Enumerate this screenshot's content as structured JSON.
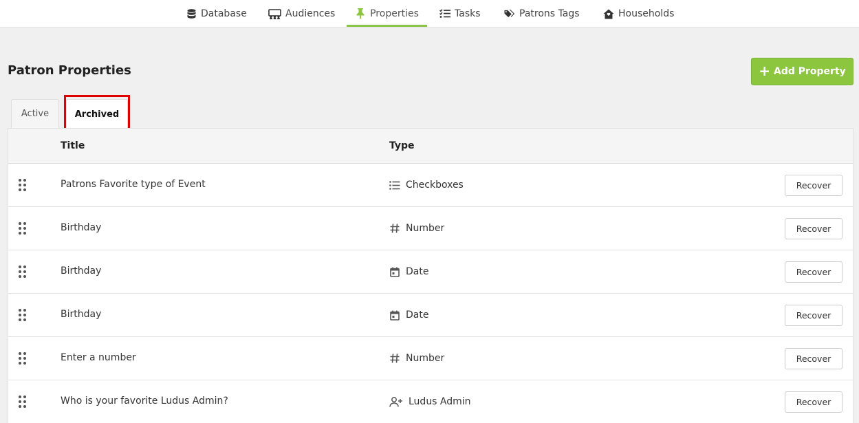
{
  "nav": {
    "items": [
      {
        "label": "Database",
        "icon": "database-icon"
      },
      {
        "label": "Audiences",
        "icon": "audience-icon"
      },
      {
        "label": "Properties",
        "icon": "pin-icon",
        "active": true
      },
      {
        "label": "Tasks",
        "icon": "checklist-icon"
      },
      {
        "label": "Patrons Tags",
        "icon": "tags-icon"
      },
      {
        "label": "Households",
        "icon": "house-icon"
      }
    ]
  },
  "header": {
    "title": "Patron Properties",
    "add_button": "Add Property"
  },
  "tabs": [
    {
      "label": "Active"
    },
    {
      "label": "Archived",
      "selected": true
    }
  ],
  "table": {
    "columns": [
      "Title",
      "Type"
    ],
    "rows": [
      {
        "title": "Patrons Favorite type of Event",
        "type": "Checkboxes",
        "type_icon": "list-icon",
        "action": "Recover"
      },
      {
        "title": "Birthday",
        "type": "Number",
        "type_icon": "hash-icon",
        "action": "Recover"
      },
      {
        "title": "Birthday",
        "type": "Date",
        "type_icon": "calendar-icon",
        "action": "Recover"
      },
      {
        "title": "Birthday",
        "type": "Date",
        "type_icon": "calendar-icon",
        "action": "Recover"
      },
      {
        "title": "Enter a number",
        "type": "Number",
        "type_icon": "hash-icon",
        "action": "Recover"
      },
      {
        "title": "Who is your favorite Ludus Admin?",
        "type": "Ludus Admin",
        "type_icon": "user-plus-icon",
        "action": "Recover"
      }
    ]
  },
  "colors": {
    "accent": "#8cc63f",
    "highlight": "#e00000"
  }
}
